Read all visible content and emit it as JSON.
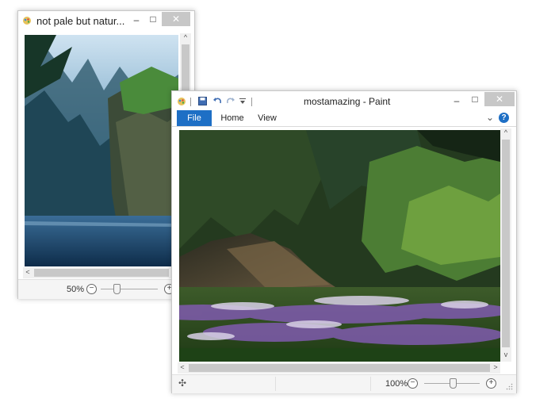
{
  "back_window": {
    "title": "not pale but natur...",
    "minimize_glyph": "–",
    "maximize_glyph": "□",
    "close_glyph": "✕",
    "zoom_label": "50%",
    "zoom_minus": "−",
    "zoom_plus": "+",
    "zoom_level": 0.5,
    "scroll_up": "^",
    "scroll_left": "<"
  },
  "front_window": {
    "title": "mostamazing - Paint",
    "minimize_glyph": "–",
    "maximize_glyph": "□",
    "close_glyph": "✕",
    "tabs": [
      {
        "label": "File"
      },
      {
        "label": "Home"
      },
      {
        "label": "View"
      }
    ],
    "help_glyph": "?",
    "expand_glyph": "⌄",
    "zoom_label": "100%",
    "zoom_minus": "−",
    "zoom_plus": "+",
    "zoom_level": 1.0,
    "move_glyph": "✣",
    "scroll_up": "^",
    "scroll_down": "v",
    "scroll_left": "<",
    "scroll_right": ">"
  },
  "colors": {
    "file_tab": "#1e6fc5",
    "help_icon": "#1e6fc5",
    "close_button": "#c7c7c7"
  }
}
